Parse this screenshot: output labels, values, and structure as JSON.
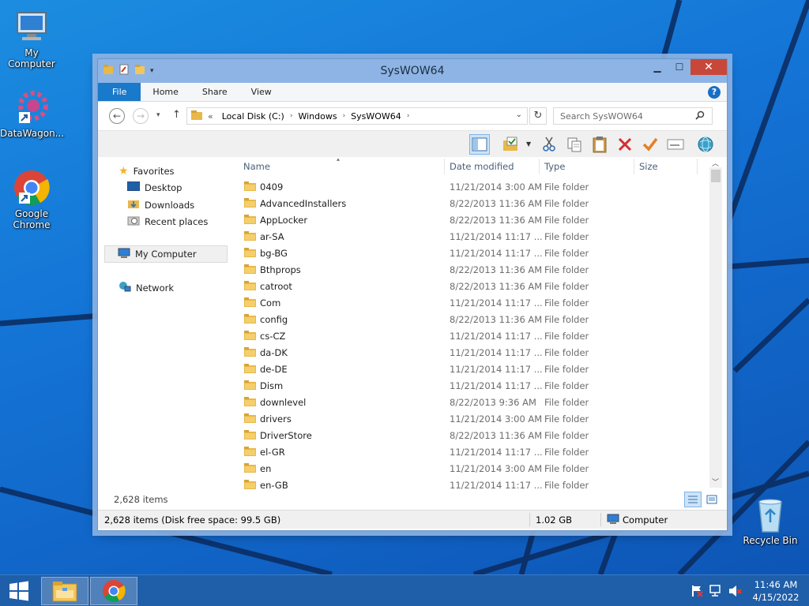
{
  "desktop": {
    "icons": [
      {
        "label": "My Computer"
      },
      {
        "label": "DataWagon..."
      },
      {
        "label_line1": "Google",
        "label_line2": "Chrome"
      },
      {
        "label": "Recycle Bin"
      }
    ]
  },
  "window": {
    "title": "SysWOW64",
    "ribbon_tabs": [
      "File",
      "Home",
      "Share",
      "View"
    ],
    "address_prefix": "«",
    "breadcrumbs": [
      "Local Disk (C:)",
      "Windows",
      "SysWOW64"
    ],
    "search_placeholder": "Search SysWOW64",
    "columns": {
      "name": "Name",
      "date": "Date modified",
      "type": "Type",
      "size": "Size"
    },
    "nav": {
      "favorites": "Favorites",
      "desktop": "Desktop",
      "downloads": "Downloads",
      "recent": "Recent places",
      "computer": "My Computer",
      "network": "Network"
    },
    "files": [
      {
        "name": "0409",
        "date": "11/21/2014 3:00 AM",
        "type": "File folder"
      },
      {
        "name": "AdvancedInstallers",
        "date": "8/22/2013 11:36 AM",
        "type": "File folder"
      },
      {
        "name": "AppLocker",
        "date": "8/22/2013 11:36 AM",
        "type": "File folder"
      },
      {
        "name": "ar-SA",
        "date": "11/21/2014 11:17 ...",
        "type": "File folder"
      },
      {
        "name": "bg-BG",
        "date": "11/21/2014 11:17 ...",
        "type": "File folder"
      },
      {
        "name": "Bthprops",
        "date": "8/22/2013 11:36 AM",
        "type": "File folder"
      },
      {
        "name": "catroot",
        "date": "8/22/2013 11:36 AM",
        "type": "File folder"
      },
      {
        "name": "Com",
        "date": "11/21/2014 11:17 ...",
        "type": "File folder"
      },
      {
        "name": "config",
        "date": "8/22/2013 11:36 AM",
        "type": "File folder"
      },
      {
        "name": "cs-CZ",
        "date": "11/21/2014 11:17 ...",
        "type": "File folder"
      },
      {
        "name": "da-DK",
        "date": "11/21/2014 11:17 ...",
        "type": "File folder"
      },
      {
        "name": "de-DE",
        "date": "11/21/2014 11:17 ...",
        "type": "File folder"
      },
      {
        "name": "Dism",
        "date": "11/21/2014 11:17 ...",
        "type": "File folder"
      },
      {
        "name": "downlevel",
        "date": "8/22/2013 9:36 AM",
        "type": "File folder"
      },
      {
        "name": "drivers",
        "date": "11/21/2014 3:00 AM",
        "type": "File folder"
      },
      {
        "name": "DriverStore",
        "date": "8/22/2013 11:36 AM",
        "type": "File folder"
      },
      {
        "name": "el-GR",
        "date": "11/21/2014 11:17 ...",
        "type": "File folder"
      },
      {
        "name": "en",
        "date": "11/21/2014 3:00 AM",
        "type": "File folder"
      },
      {
        "name": "en-GB",
        "date": "11/21/2014 11:17 ...",
        "type": "File folder"
      }
    ],
    "item_count": "2,628 items",
    "status": {
      "items_free": "2,628 items (Disk free space: 99.5 GB)",
      "size": "1.02 GB",
      "location": "Computer"
    }
  },
  "taskbar": {
    "time": "11:46 AM",
    "date": "4/15/2022"
  }
}
